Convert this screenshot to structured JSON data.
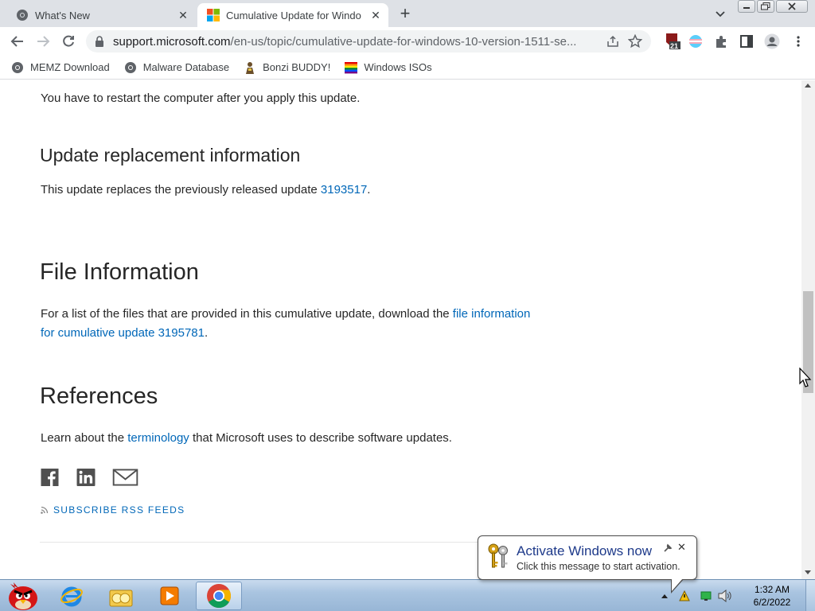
{
  "browser": {
    "tabs": [
      {
        "title": "What's New",
        "active": false
      },
      {
        "title": "Cumulative Update for Windo",
        "active": true
      }
    ],
    "address": {
      "host": "support.microsoft.com",
      "path": "/en-us/topic/cumulative-update-for-windows-10-version-1511-se..."
    },
    "extension_badge": "21",
    "bookmarks": [
      {
        "label": "MEMZ Download",
        "icon": "chrome-favicon-icon"
      },
      {
        "label": "Malware Database",
        "icon": "chrome-favicon-icon"
      },
      {
        "label": "Bonzi BUDDY!",
        "icon": "bonzi-icon"
      },
      {
        "label": "Windows ISOs",
        "icon": "rainbow-flag-icon"
      }
    ]
  },
  "article": {
    "restart_note": "You have to restart the computer after you apply this update.",
    "replacement": {
      "heading": "Update replacement information",
      "text_before": "This update replaces the previously released update ",
      "link": "3193517",
      "text_after": "."
    },
    "file_info": {
      "heading": "File Information",
      "text_line1_before": "For a list of the files that are provided in this cumulative update, download the ",
      "link_line1": "file information",
      "link_line2": "for cumulative update 3195781",
      "text_after": "."
    },
    "references": {
      "heading": "References",
      "text_before": "Learn about the ",
      "link": "terminology",
      "text_after": " that Microsoft uses to describe software updates."
    },
    "share_icons": [
      "facebook-icon",
      "linkedin-icon",
      "email-icon"
    ],
    "rss_label": "SUBSCRIBE RSS FEEDS"
  },
  "notification": {
    "title": "Activate Windows now",
    "message": "Click this message to start activation."
  },
  "taskbar": {
    "apps": [
      "angry-birds-icon",
      "internet-explorer-icon",
      "windows-explorer-icon",
      "media-player-icon",
      "chrome-icon"
    ],
    "time": "1:32 AM",
    "date": "6/2/2022"
  },
  "colors": {
    "link": "#0067b8",
    "text": "#262626",
    "tabstrip": "#dee1e6"
  }
}
